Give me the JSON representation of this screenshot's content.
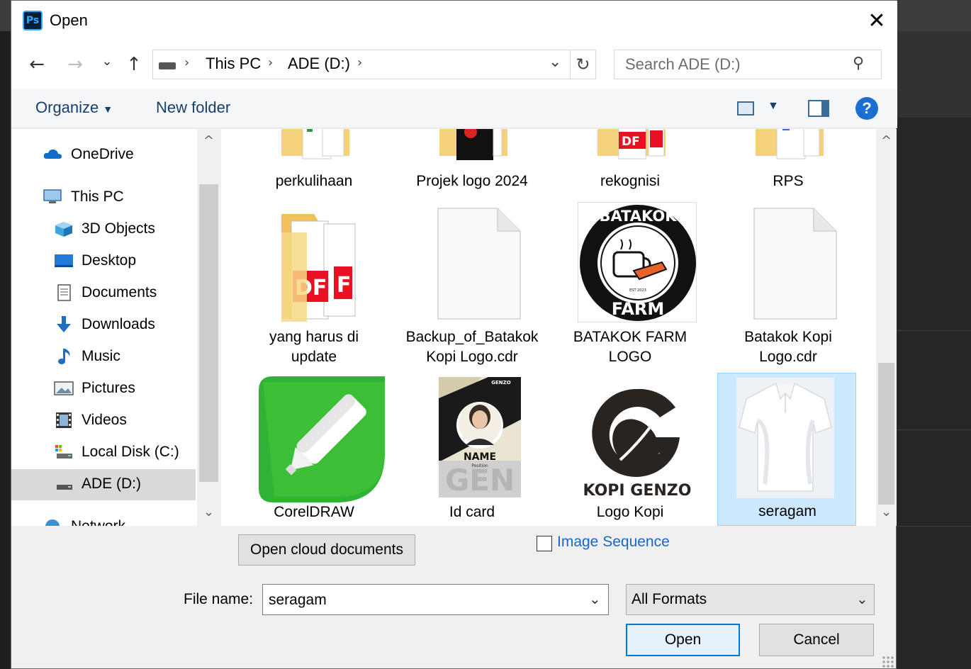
{
  "window": {
    "title": "Open",
    "app_icon": "Ps",
    "close_icon": "close-icon"
  },
  "nav": {
    "back": "←",
    "forward": "→",
    "recent": "⌄",
    "up": "↑",
    "breadcrumb": [
      "This PC",
      "ADE (D:)"
    ],
    "refresh": "↻",
    "search_placeholder": "Search ADE (D:)"
  },
  "toolbar": {
    "organize": "Organize",
    "new_folder": "New folder",
    "help": "?"
  },
  "sidebar": {
    "items": [
      {
        "label": "OneDrive",
        "icon": "onedrive-icon"
      },
      {
        "label": "This PC",
        "icon": "computer-icon"
      },
      {
        "label": "3D Objects",
        "icon": "3d-objects-icon"
      },
      {
        "label": "Desktop",
        "icon": "desktop-icon"
      },
      {
        "label": "Documents",
        "icon": "documents-icon"
      },
      {
        "label": "Downloads",
        "icon": "downloads-icon"
      },
      {
        "label": "Music",
        "icon": "music-icon"
      },
      {
        "label": "Pictures",
        "icon": "pictures-icon"
      },
      {
        "label": "Videos",
        "icon": "videos-icon"
      },
      {
        "label": "Local Disk (C:)",
        "icon": "drive-icon"
      },
      {
        "label": "ADE (D:)",
        "icon": "drive-icon",
        "selected": true
      },
      {
        "label": "Network",
        "icon": "network-icon"
      }
    ]
  },
  "files": [
    {
      "name": "perkulihaan",
      "type": "folder"
    },
    {
      "name": "Projek logo 2024",
      "type": "folder"
    },
    {
      "name": "rekognisi",
      "type": "folder"
    },
    {
      "name": "RPS",
      "type": "folder"
    },
    {
      "name": "yang harus di update",
      "type": "folder"
    },
    {
      "name": "Backup_of_Batakok Kopi Logo.cdr",
      "type": "file"
    },
    {
      "name": "BATAKOK FARM LOGO",
      "type": "image",
      "logo_top": "BATAKOK",
      "logo_bottom": "FARM",
      "logo_small": "EST 2023"
    },
    {
      "name": "Batakok Kopi Logo.cdr",
      "type": "file"
    },
    {
      "name": "CorelDRAW",
      "type": "app"
    },
    {
      "name": "Id card",
      "type": "image",
      "card_top": "GENZO",
      "card_name": "NAME",
      "card_position": "Position",
      "card_bg": "GEN"
    },
    {
      "name": "Logo Kopi",
      "type": "image",
      "logo_text": "KOPI GENZO"
    },
    {
      "name": "seragam",
      "type": "image",
      "selected": true
    }
  ],
  "bottom": {
    "open_cloud": "Open cloud documents",
    "image_sequence": "Image Sequence",
    "file_name_label": "File name:",
    "file_name_value": "seragam",
    "filter_value": "All Formats",
    "open_button": "Open",
    "cancel_button": "Cancel"
  },
  "colors": {
    "accent": "#0078d7",
    "selection": "#cce8ff",
    "link": "#1a67c9",
    "pdf_red": "#e81123",
    "corel_green": "#2fb335"
  }
}
